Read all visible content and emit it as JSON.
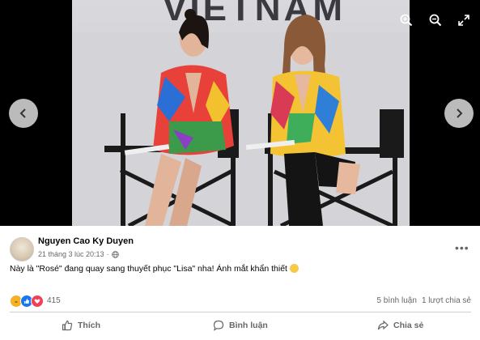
{
  "photo": {
    "banner_text": "VIETNAM"
  },
  "toolbar": {
    "zoom_in_icon": "zoom-in-icon",
    "zoom_out_icon": "zoom-out-icon",
    "fullscreen_icon": "expand-icon"
  },
  "navigation": {
    "prev_icon": "chevron-left-icon",
    "next_icon": "chevron-right-icon"
  },
  "post": {
    "author": "Nguyen Cao Ky Duyen",
    "timestamp": "21 tháng 3 lúc 20:13",
    "separator": "·",
    "caption": "Này là \"Rosé\" đang quay sang thuyết phục \"Lisa\" nha! Ánh mắt khẩn thiết",
    "more_label": "•••"
  },
  "engagement": {
    "reaction_count": "415",
    "comments": "5 bình luận",
    "shares": "1 lượt chia sẻ"
  },
  "actions": {
    "like": "Thích",
    "comment": "Bình luận",
    "share": "Chia sẻ"
  },
  "colors": {
    "accent": "#1877f2",
    "muted_text": "#65676b",
    "love": "#f33e58",
    "haha": "#f7b125"
  }
}
